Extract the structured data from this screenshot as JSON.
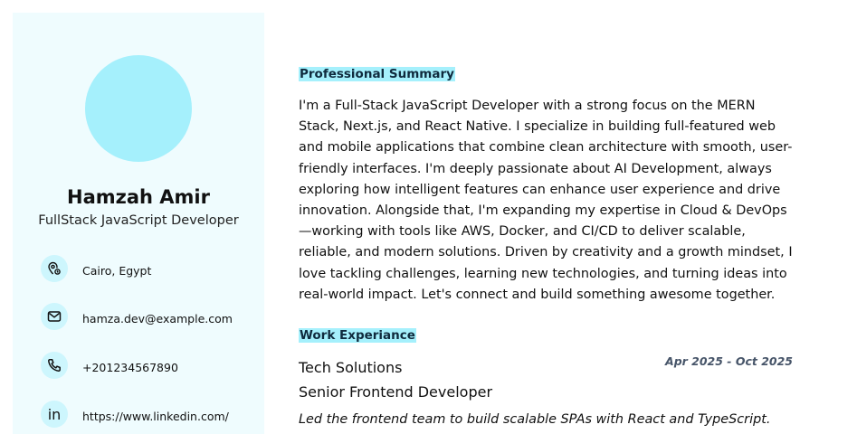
{
  "profile": {
    "name": "Hamzah Amir",
    "title": "FullStack JavaScript Developer"
  },
  "contacts": [
    {
      "icon": "location-icon",
      "text": "Cairo, Egypt"
    },
    {
      "icon": "mail-icon",
      "text": "hamza.dev@example.com"
    },
    {
      "icon": "phone-icon",
      "text": "+201234567890"
    },
    {
      "icon": "linkedin-icon",
      "glyph": "in",
      "text": "https://www.linkedin.com/"
    }
  ],
  "summary": {
    "heading": "Professional Summary",
    "text": "I'm a Full-Stack JavaScript Developer with a strong focus on the MERN Stack, Next.js, and React Native. I specialize in building full-featured web and mobile applications that combine clean architecture with smooth, user-friendly interfaces. I'm deeply passionate about AI Development, always exploring how intelligent features can enhance user experience and drive innovation. Alongside that, I'm expanding my expertise in Cloud & DevOps—working with tools like AWS, Docker, and CI/CD to deliver scalable, reliable, and modern solutions. Driven by creativity and a growth mindset, I love tackling challenges, learning new technologies, and turning ideas into real-world impact. Let's connect and build something awesome together."
  },
  "experience": {
    "heading": "Work Experiance",
    "items": [
      {
        "company": "Tech Solutions",
        "dates": "Apr 2025 - Oct 2025",
        "role": "Senior Frontend Developer",
        "description": "Led the frontend team to build scalable SPAs with React and TypeScript."
      }
    ]
  },
  "colors": {
    "sidebar_bg": "#effcfe",
    "accent": "#a5f0fc",
    "icon_bg": "#cdf6fd",
    "heading_text": "#0f2a3d",
    "date_text": "#475569"
  }
}
